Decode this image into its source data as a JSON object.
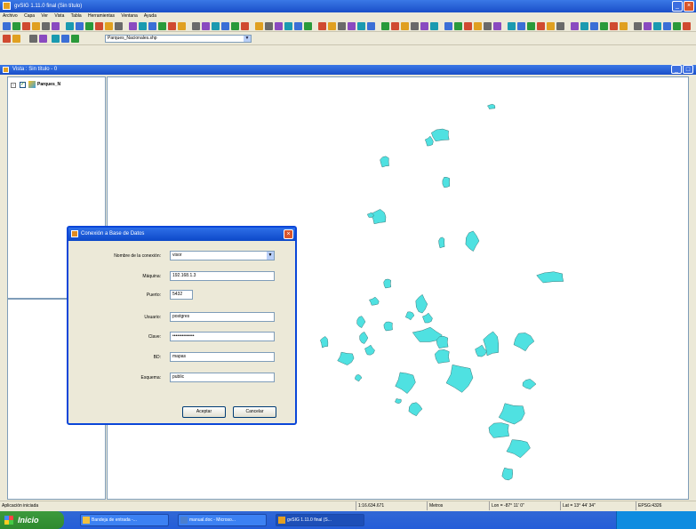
{
  "window": {
    "title": "gvSIG 1.11.0 final (Sin título)"
  },
  "menu": {
    "items": [
      "Archivo",
      "Capa",
      "Ver",
      "Vista",
      "Tabla",
      "Herramientas",
      "Ventana",
      "Ayuda"
    ]
  },
  "toolbar": {
    "layer_combo_value": "Parques_Nacionales.shp"
  },
  "vista": {
    "title": "Vista : Sin título - 0"
  },
  "toc": {
    "layer_label": "Parques_N"
  },
  "dialog": {
    "title": "Conexión a Base de Datos",
    "fields": [
      {
        "label": "Nombre de la conexión:",
        "value": "visor"
      },
      {
        "label": "Máquina:",
        "value": "192.168.1.3"
      },
      {
        "label": "Puerto:",
        "value": "5432"
      },
      {
        "label": "Usuario:",
        "value": "postgres"
      },
      {
        "label": "Clave:",
        "value": "••••••••••••••"
      },
      {
        "label": "BD:",
        "value": "mapas"
      },
      {
        "label": "Esquema:",
        "value": "public"
      }
    ],
    "accept_label": "Aceptar",
    "cancel_label": "Cancelar"
  },
  "status": {
    "left": "Aplicación iniciada",
    "scale": "1:16.634.671",
    "units": "Metros",
    "lon": "Lon = -87° 11' 0\"",
    "lat": "Lat = 13° 44' 34\"",
    "epsg": "EPSG:4326"
  },
  "taskbar": {
    "start_label": "Inicio",
    "tasks": [
      "Bandeja de entrada -...",
      "manual.doc - Microso...",
      "gvSIG 1.11.0 final (S..."
    ]
  },
  "colors": {
    "feature_fill": "#4fe1e1",
    "titlebar": "#1a4fc8"
  }
}
